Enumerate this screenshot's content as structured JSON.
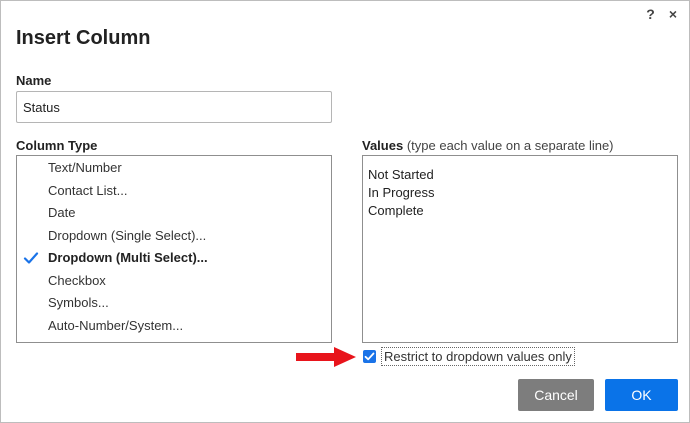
{
  "dialog": {
    "title": "Insert Column",
    "help_icon": "?",
    "close_icon": "×"
  },
  "name": {
    "label": "Name",
    "value": "Status"
  },
  "column_type": {
    "label": "Column Type",
    "items": [
      {
        "label": "Text/Number",
        "selected": false
      },
      {
        "label": "Contact List...",
        "selected": false
      },
      {
        "label": "Date",
        "selected": false
      },
      {
        "label": "Dropdown (Single Select)...",
        "selected": false
      },
      {
        "label": "Dropdown (Multi Select)...",
        "selected": true
      },
      {
        "label": "Checkbox",
        "selected": false
      },
      {
        "label": "Symbols...",
        "selected": false
      },
      {
        "label": "Auto-Number/System...",
        "selected": false
      }
    ]
  },
  "values": {
    "label": "Values",
    "hint": "(type each value on a separate line)",
    "lines": [
      "Not Started",
      "In Progress",
      "Complete"
    ]
  },
  "restrict": {
    "label": "Restrict to dropdown values only",
    "checked": true
  },
  "buttons": {
    "cancel": "Cancel",
    "ok": "OK"
  },
  "colors": {
    "accent": "#0a73e8",
    "check": "#1a73e8",
    "cancel_bg": "#7d7d7d",
    "arrow": "#e8141b"
  }
}
